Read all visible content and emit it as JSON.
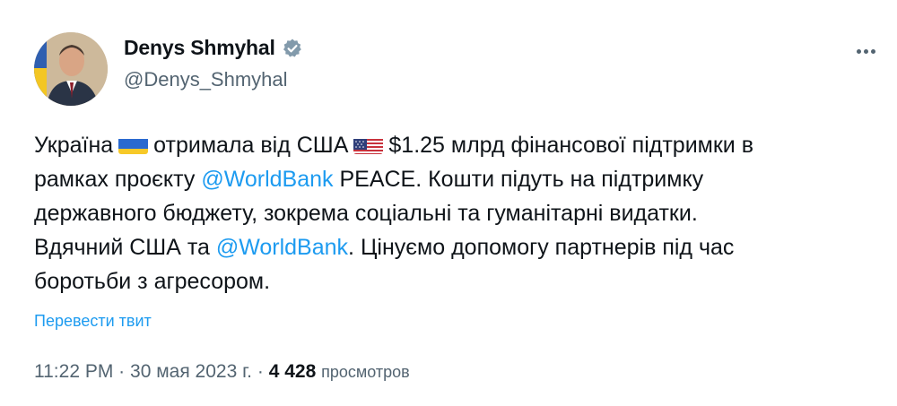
{
  "author": {
    "name": "Denys Shmyhal",
    "handle": "@Denys_Shmyhal"
  },
  "tweet": {
    "line1": {
      "a": "Україна",
      "b": "отримала від США",
      "c": "$1.25 млрд фінансової підтримки в"
    },
    "line2": {
      "a": "рамках проєкту ",
      "mention": "@WorldBank",
      "b": " PEACE. Кошти підуть на підтримку"
    },
    "line3": "державного бюджету, зокрема соціальні та гуманітарні видатки.",
    "line4": {
      "a": "Вдячний США та ",
      "mention": "@WorldBank",
      "b": ". Цінуємо допомогу партнерів під час"
    },
    "line5": "боротьби з агресором.",
    "flags": [
      "flag-ukraine-icon",
      "flag-usa-icon"
    ]
  },
  "translate_label": "Перевести твит",
  "meta": {
    "time": "11:22 PM",
    "separator": "·",
    "date": "30 мая 2023 г.",
    "views_count": "4 428",
    "views_label": "просмотров"
  },
  "colors": {
    "link": "#1d9bf0",
    "text": "#0f1419",
    "secondary": "#536471",
    "verified": "#829aab"
  }
}
